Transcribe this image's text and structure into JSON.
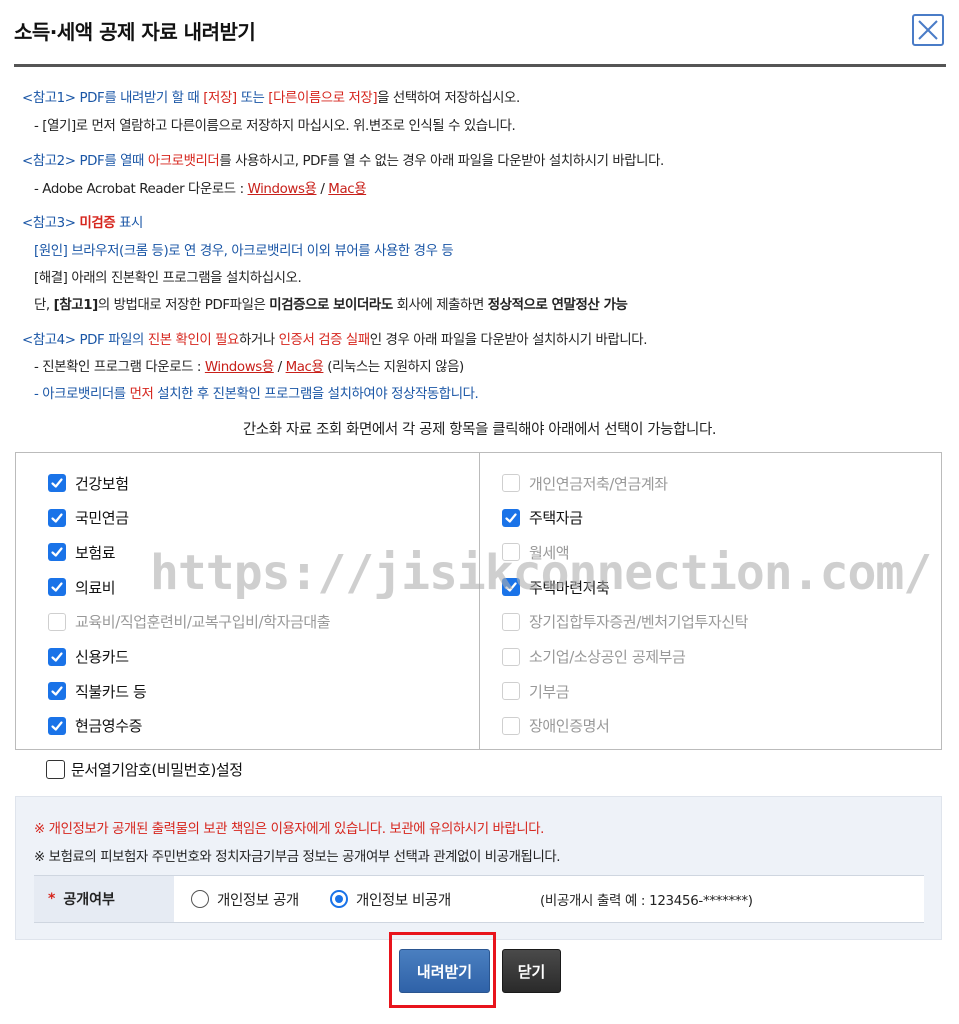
{
  "dialog": {
    "title": "소득·세액 공제 자료 내려받기",
    "close_icon": "close-x-icon"
  },
  "notes": {
    "note1_head": "<참고1> PDF를 내려받기 할 때 ",
    "note1_save": "[저장]",
    "note1_or": " 또는 ",
    "note1_saveas": "[다른이름으로 저장]",
    "note1_tail": "을 선택하여 저장하십시오.",
    "note1_sub": "- [열기]로 먼저 열람하고 다른이름으로 저장하지 마십시오. 위.변조로 인식될 수 있습니다.",
    "note2_head": "<참고2> PDF를 열때 ",
    "note2_acro": "아크로뱃리더",
    "note2_tail": "를 사용하시고, PDF를 열 수 없는 경우 아래 파일을 다운받아 설치하시기 바랍니다.",
    "note2_sub_label": "- Adobe Acrobat Reader 다운로드 : ",
    "note2_win": "Windows용",
    "note2_sep": " / ",
    "note2_mac": "Mac용",
    "note3_head": "<참고3> ",
    "note3_bold": "미검증",
    "note3_tail": " 표시",
    "note3_cause": "[원인] 브라우저(크롬 등)로 연 경우, 아크로뱃리더 이외 뷰어를 사용한 경우 등",
    "note3_fix": "[해결] 아래의 진본확인 프로그램을 설치하십시오.",
    "note3_l3_a": "단, ",
    "note3_l3_b": "[참고1]",
    "note3_l3_c": "의 방법대로 저장한 PDF파일은 ",
    "note3_l3_d": "미검증으로 보이더라도",
    "note3_l3_e": " 회사에 제출하면 ",
    "note3_l3_f": "정상적으로 연말정산 가능",
    "note4_head": "<참고4> PDF 파일의 ",
    "note4_red1": "진본 확인이 필요",
    "note4_mid1": "하거나 ",
    "note4_red2": "인증서 검증 실패",
    "note4_tail": "인 경우 아래 파일을 다운받아 설치하시기 바랍니다.",
    "note4_sub_label": "- 진본확인 프로그램 다운로드 : ",
    "note4_win": "Windows용",
    "note4_sep": " / ",
    "note4_mac": "Mac용",
    "note4_sub_tail": " (리눅스는 지원하지 않음)",
    "note4_warn_a": "- 아크로뱃리더를 ",
    "note4_warn_b": "먼저",
    "note4_warn_c": " 설치한 후 진본확인 프로그램을 설치하여야 정상작동합니다."
  },
  "instruction": "간소화 자료 조회 화면에서 각 공제 항목을 클릭해야 아래에서 선택이 가능합니다.",
  "left_items": [
    {
      "label": "건강보험",
      "checked": true
    },
    {
      "label": "국민연금",
      "checked": true
    },
    {
      "label": "보험료",
      "checked": true
    },
    {
      "label": "의료비",
      "checked": true
    },
    {
      "label": "교육비/직업훈련비/교복구입비/학자금대출",
      "checked": false
    },
    {
      "label": "신용카드",
      "checked": true
    },
    {
      "label": "직불카드 등",
      "checked": true
    },
    {
      "label": "현금영수증",
      "checked": true
    }
  ],
  "right_items": [
    {
      "label": "개인연금저축/연금계좌",
      "checked": false
    },
    {
      "label": "주택자금",
      "checked": true
    },
    {
      "label": "월세액",
      "checked": false
    },
    {
      "label": "주택마련저축",
      "checked": true
    },
    {
      "label": "장기집합투자증권/벤처기업투자신탁",
      "checked": false
    },
    {
      "label": "소기업/소상공인 공제부금",
      "checked": false
    },
    {
      "label": "기부금",
      "checked": false
    },
    {
      "label": "장애인증명서",
      "checked": false
    }
  ],
  "watermark": "https://jisikconnection.com/",
  "password_option": {
    "label": "문서열기암호(비밀번호)설정",
    "checked": false
  },
  "privacy": {
    "warning": "※ 개인정보가 공개된 출력물의 보관 책임은 이용자에게 있습니다. 보관에 유의하시기 바랍니다.",
    "info": "※ 보험료의 피보험자 주민번호와 정치자금기부금 정보는 공개여부 선택과 관계없이 비공개됩니다.",
    "label_star": "*",
    "label": "공개여부",
    "option_public": "개인정보 공개",
    "option_private": "개인정보 비공개",
    "selected": "private",
    "example": "(비공개시 출력 예 : 123456-*******)"
  },
  "buttons": {
    "download": "내려받기",
    "close": "닫기"
  },
  "colors": {
    "accent_blue": "#1a73e8",
    "note_blue": "#1a56a6",
    "warning_red": "#d6251d",
    "highlight_red": "#e8141c"
  }
}
